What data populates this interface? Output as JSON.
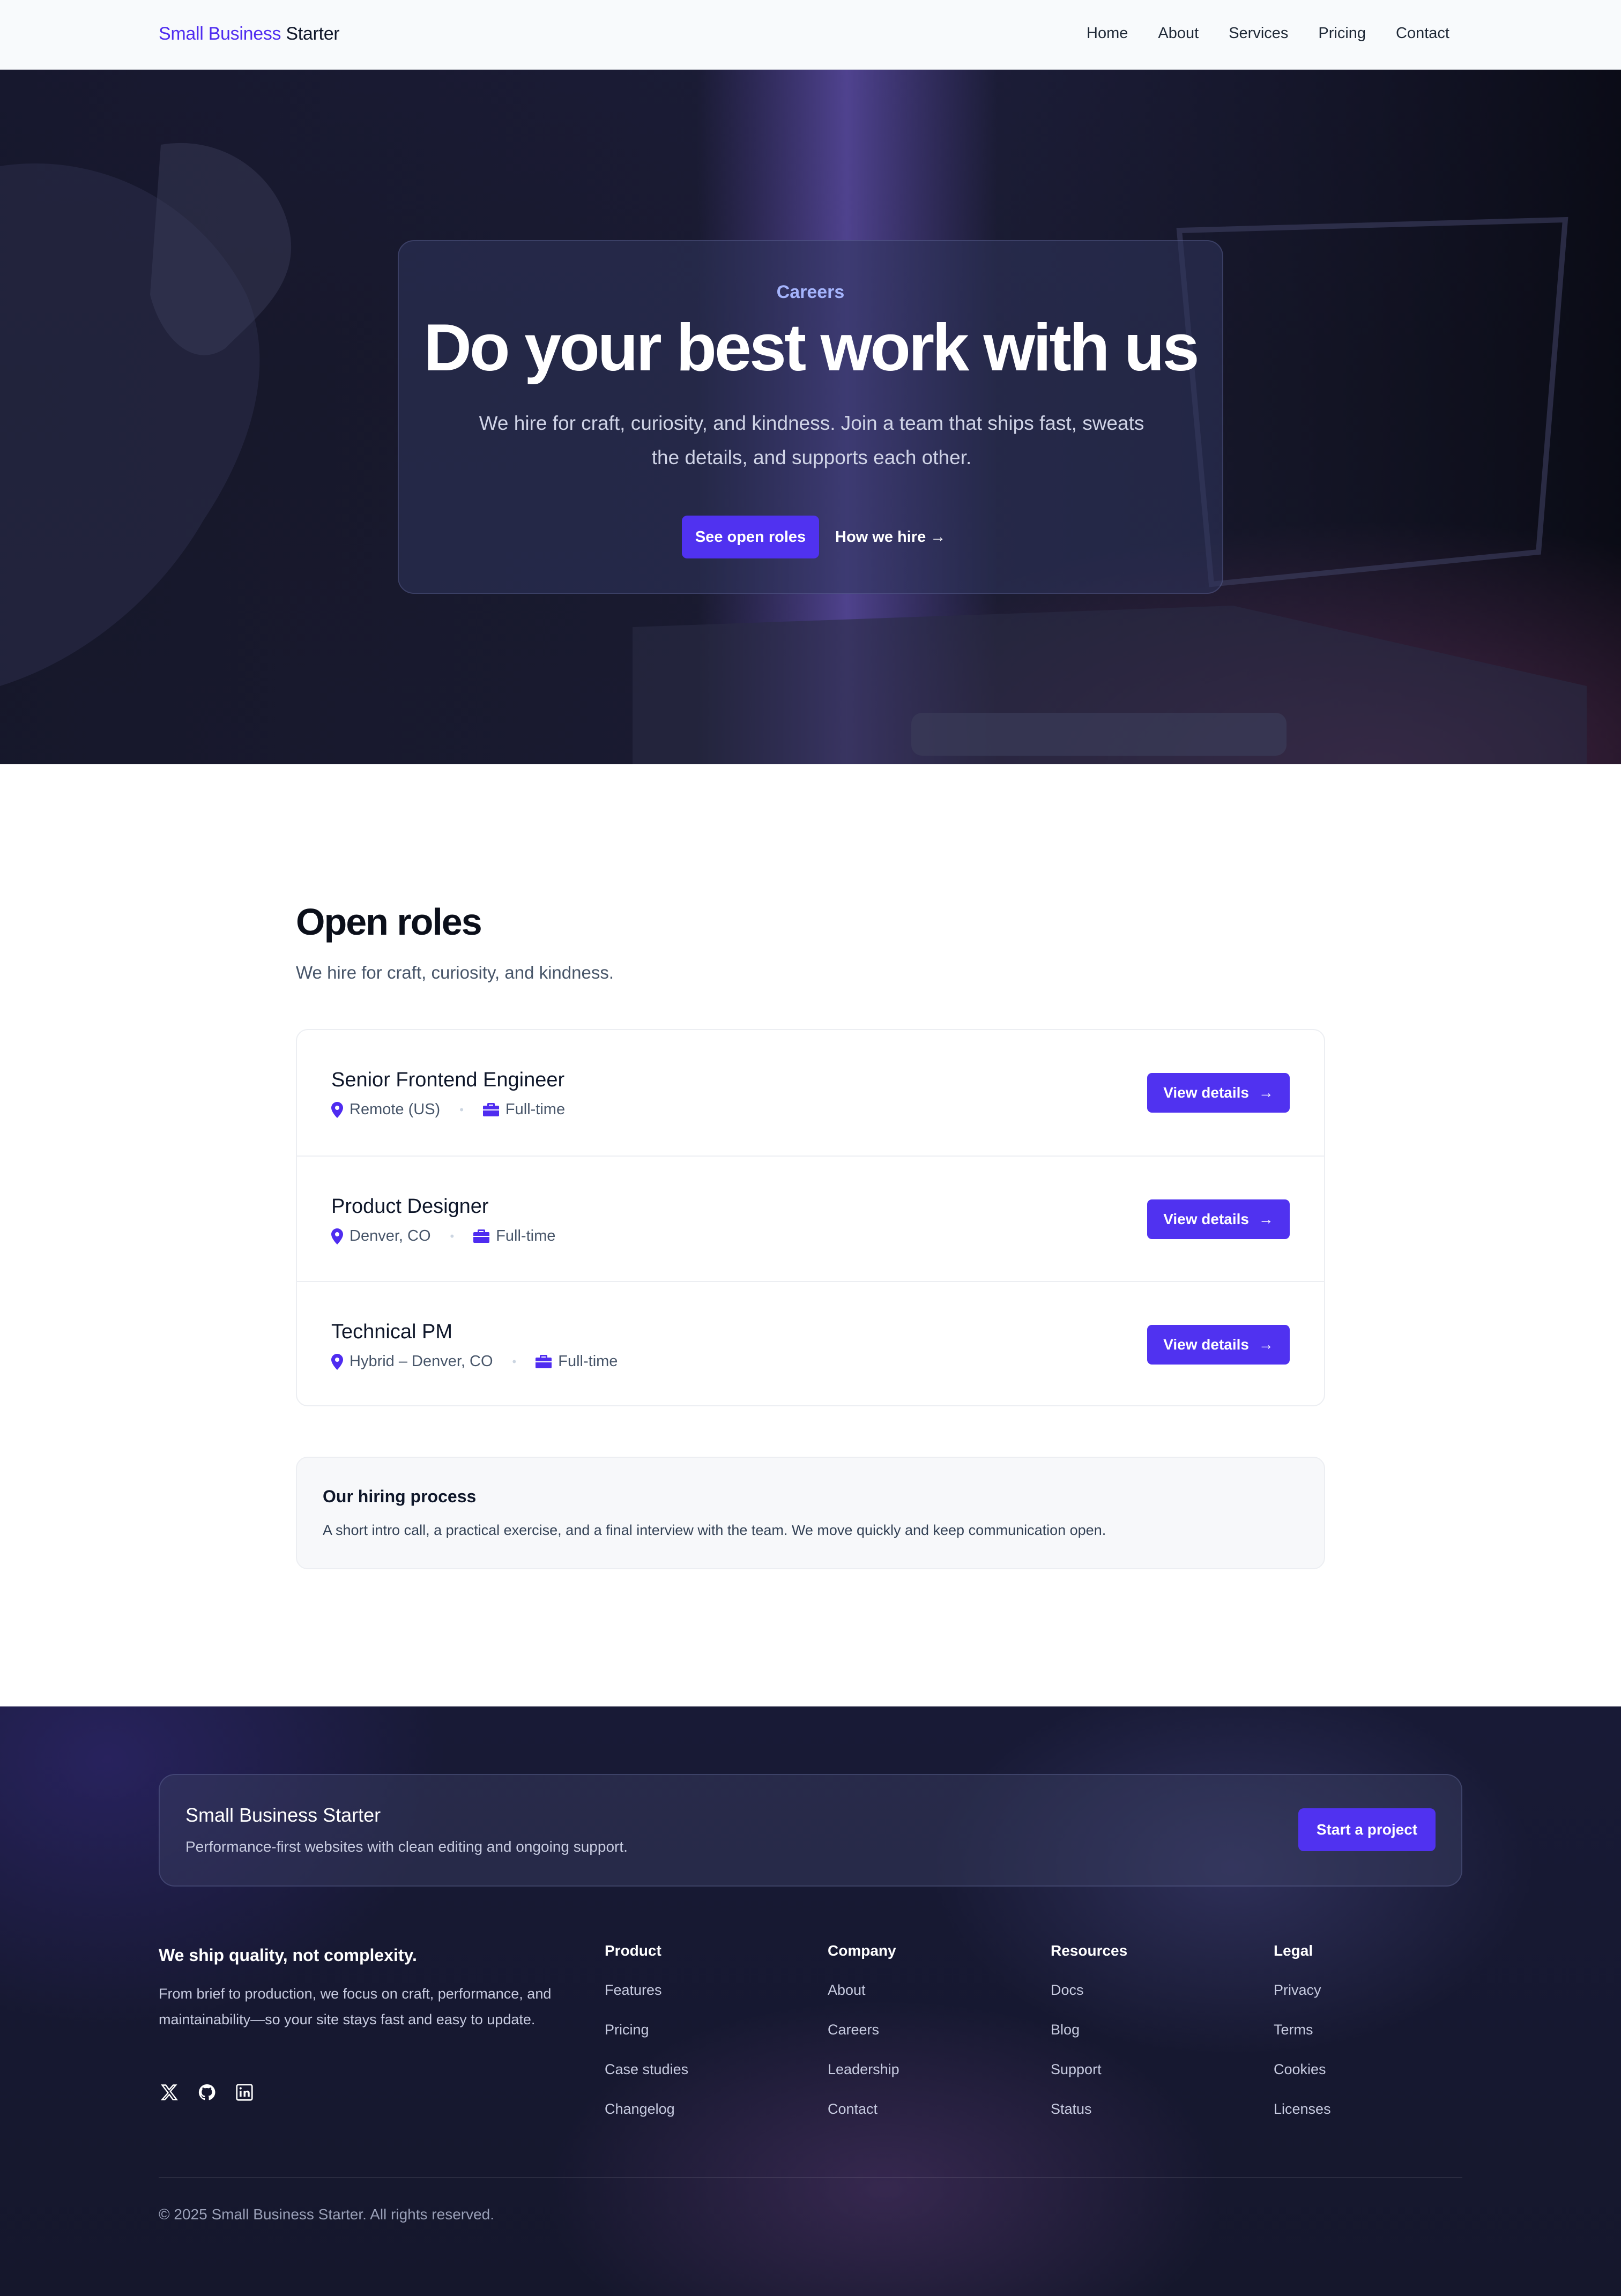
{
  "nav": {
    "brand_primary": "Small Business",
    "brand_secondary": "Starter",
    "links": [
      "Home",
      "About",
      "Services",
      "Pricing",
      "Contact"
    ]
  },
  "hero": {
    "eyebrow": "Careers",
    "title": "Do your best work with us",
    "subtitle": "We hire for craft, curiosity, and kindness. Join a team that ships fast, sweats the details, and supports each other.",
    "primary_button": "See open roles",
    "secondary_link": "How we hire →"
  },
  "roles": {
    "title": "Open roles",
    "subtitle": "We hire for craft, curiosity, and kindness.",
    "items": [
      {
        "title": "Senior Frontend Engineer",
        "location": "Remote (US)",
        "type": "Full-time",
        "button": "View details"
      },
      {
        "title": "Product Designer",
        "location": "Denver, CO",
        "type": "Full-time",
        "button": "View details"
      },
      {
        "title": "Technical PM",
        "location": "Hybrid – Denver, CO",
        "type": "Full-time",
        "button": "View details"
      }
    ],
    "icons": {
      "location": "map-pin-icon",
      "type": "briefcase-icon",
      "button": "arrow-right-icon"
    }
  },
  "process": {
    "title": "Our hiring process",
    "text": "A short intro call, a practical exercise, and a final interview with the team. We move quickly and keep communication open."
  },
  "footer": {
    "cta_title": "Small Business Starter",
    "cta_subtitle": "Performance-first websites with clean editing and ongoing support.",
    "cta_button": "Start a project",
    "tagline": "We ship quality, not complexity.",
    "about": "From brief to production, we focus on craft, performance, and maintainability—so your site stays fast and easy to update.",
    "socials": [
      "x-icon",
      "github-icon",
      "linkedin-icon"
    ],
    "columns": [
      {
        "title": "Product",
        "items": [
          "Features",
          "Pricing",
          "Case studies",
          "Changelog"
        ]
      },
      {
        "title": "Company",
        "items": [
          "About",
          "Careers",
          "Leadership",
          "Contact"
        ]
      },
      {
        "title": "Resources",
        "items": [
          "Docs",
          "Blog",
          "Support",
          "Status"
        ]
      },
      {
        "title": "Legal",
        "items": [
          "Privacy",
          "Terms",
          "Cookies",
          "Licenses"
        ]
      }
    ],
    "copyright": "© 2025 Small Business Starter. All rights reserved."
  },
  "colors": {
    "accent": "#5032f0",
    "brand": "#4f2cf0",
    "hero_bg": "#1c1d38",
    "footer_bg": "#181a36"
  }
}
